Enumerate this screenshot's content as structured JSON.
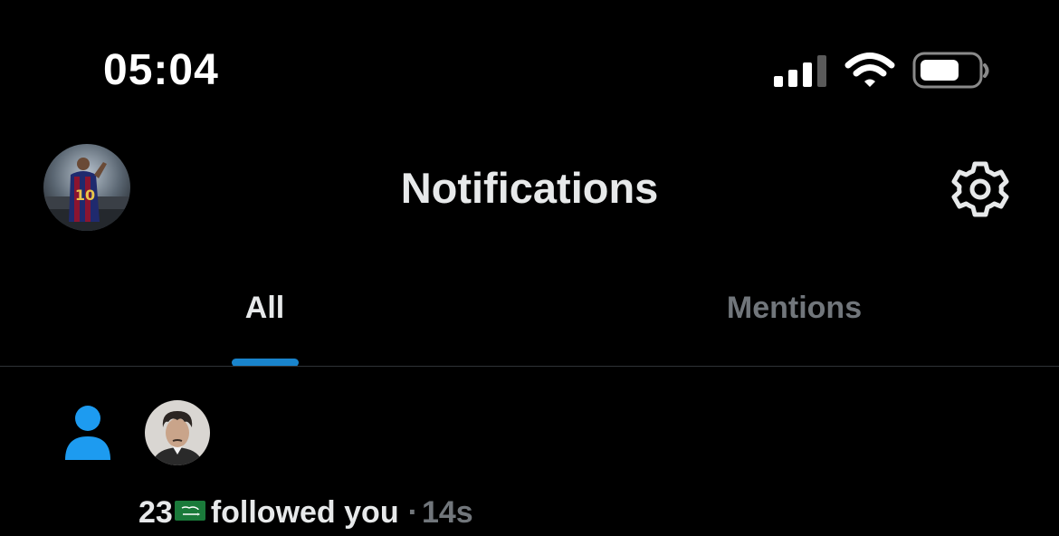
{
  "status_bar": {
    "time": "05:04",
    "icons": [
      "cellular-signal-icon",
      "wifi-icon",
      "battery-icon"
    ]
  },
  "header": {
    "title": "Notifications",
    "profile_avatar": "profile-avatar",
    "settings_icon": "gear-icon"
  },
  "tabs": [
    {
      "label": "All",
      "selected": true
    },
    {
      "label": "Mentions",
      "selected": false
    }
  ],
  "notifications": [
    {
      "type_icon": "person-icon",
      "user_name": "23",
      "flag": "saudi-flag-icon",
      "action": "followed you",
      "separator": "·",
      "time_ago": "14s"
    }
  ],
  "colors": {
    "background": "#000000",
    "accent": "#1d9bf0",
    "text_primary": "#e7e9ea",
    "text_secondary": "#71767b",
    "divider": "#2f3336"
  }
}
